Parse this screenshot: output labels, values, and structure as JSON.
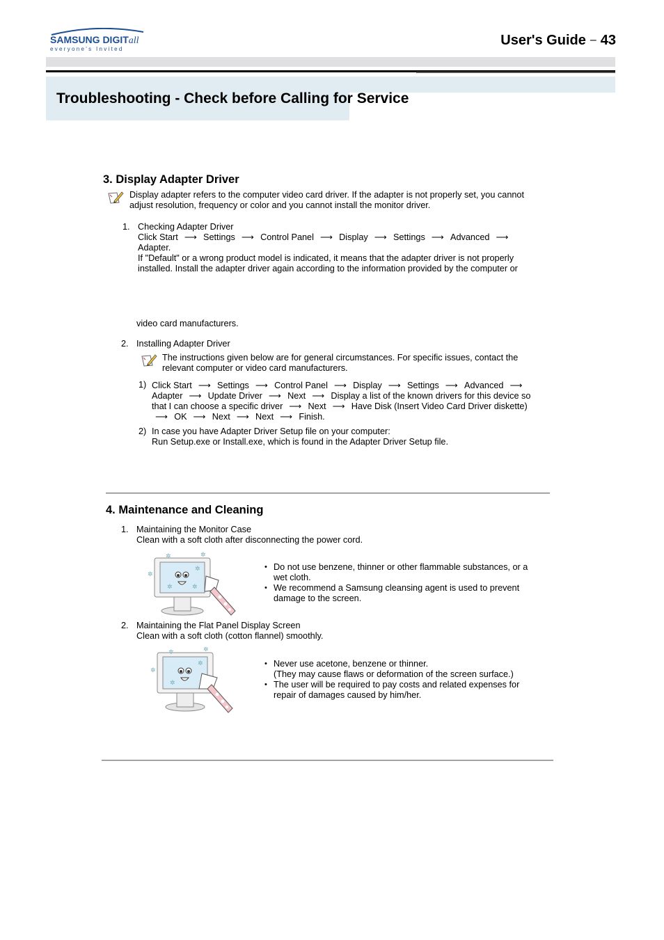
{
  "header": {
    "logo_brand": "SAMSUNG DIGITall",
    "logo_tagline": "everyone's Invited",
    "guide_label": "User's Guide",
    "separator": "–",
    "page_number": "43",
    "page_title": "Troubleshooting  - Check before Calling for Service"
  },
  "section3": {
    "heading": "3. Display Adapter Driver",
    "note_icon": "note-pencil-icon",
    "note_lines": [
      "Display adapter refers to the computer video card driver. If the adapter is not properly set, you cannot",
      "adjust resolution, frequency or color and you cannot install the monitor driver."
    ],
    "item1": {
      "number": "1.",
      "title": "Checking Adapter Driver",
      "path": [
        "Click Start",
        "Settings",
        "Control Panel",
        "Display",
        "Settings",
        "Advanced"
      ],
      "path_end": "Adapter.",
      "lines": [
        "If \"Default\" or a wrong product model is indicated, it means that the adapter driver is not properly",
        "installed. Install the adapter driver again according to the information provided by the computer or"
      ],
      "continued": "video card manufacturers."
    },
    "item2": {
      "number": "2.",
      "title": "Installing Adapter Driver",
      "note_lines": [
        "The instructions given below are for general circumstances. For specific issues, contact the",
        "relevant computer or video card manufacturers."
      ],
      "steps": [
        {
          "number": "1)",
          "line1": [
            "Click Start",
            "Settings",
            "Control Panel",
            "Display",
            "Settings",
            "Advanced"
          ],
          "line2": [
            "Adapter",
            "Update Driver",
            "Next",
            "Display a list of the known drivers for this device so"
          ],
          "line3": [
            "that I can choose a specific driver",
            "Next",
            "Have Disk (Insert Video Card Driver diskette)"
          ],
          "line4": [
            "OK",
            "Next",
            "Next",
            "Finish."
          ]
        },
        {
          "number": "2)",
          "lines": [
            "In case you have Adapter Driver Setup file on your computer:",
            "Run Setup.exe or Install.exe, which is found in the Adapter Driver Setup file."
          ]
        }
      ]
    },
    "arrow": "⟶"
  },
  "section4": {
    "heading": "4. Maintenance and Cleaning",
    "items": [
      {
        "number": "1.",
        "title": "Maintaining the Monitor Case",
        "subtitle": "Clean with a soft cloth after disconnecting the power cord.",
        "illustration": "monitor-cleaning-illustration",
        "bullets": [
          [
            "Do not use benzene, thinner or other flammable substances, or a",
            "wet cloth."
          ],
          [
            "We recommend a Samsung cleansing agent is used to prevent",
            "damage to the screen."
          ]
        ]
      },
      {
        "number": "2.",
        "title": "Maintaining the Flat Panel Display Screen",
        "subtitle": "Clean with a soft cloth (cotton flannel) smoothly.",
        "illustration": "screen-cleaning-illustration",
        "bullets": [
          [
            "Never use acetone, benzene or thinner.",
            "(They may cause flaws or deformation of the screen surface.)"
          ],
          [
            "The user will be required to pay costs and related expenses for",
            "repair of damages caused by him/her."
          ]
        ]
      }
    ]
  },
  "colors": {
    "header_gray": "#e0e0e2",
    "title_band_blue": "#e0ebf2",
    "logo_blue": "#1d4f91"
  }
}
